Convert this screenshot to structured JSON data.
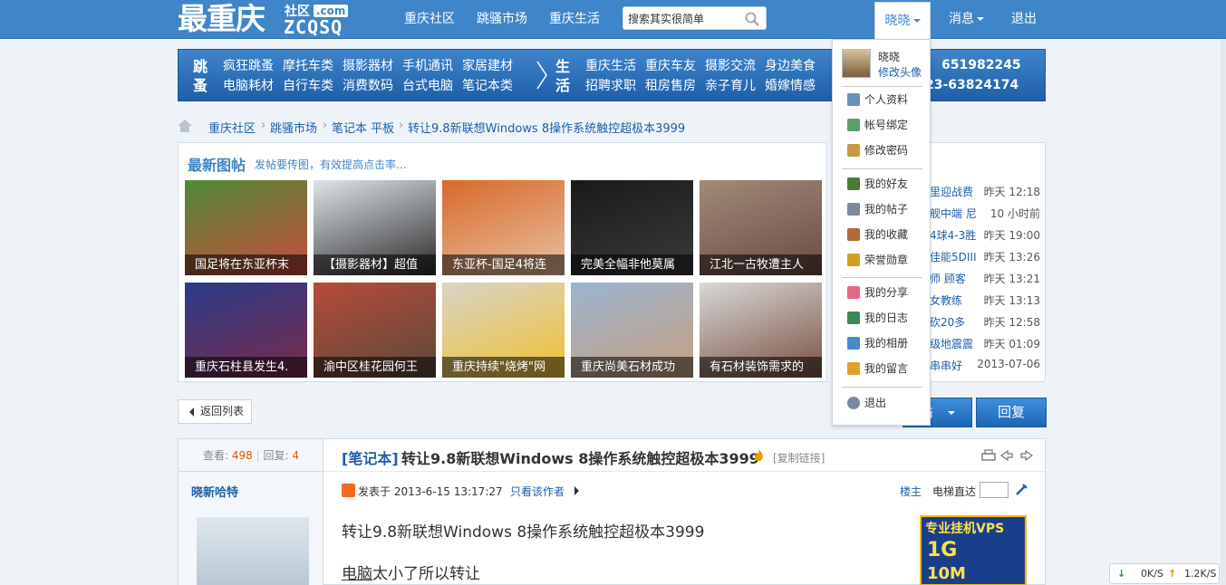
{
  "site": {
    "logo_cn": "最重庆",
    "logo_she": "社区",
    "logo_com": ".com",
    "logo_en": "ZCQSQ"
  },
  "topnav": {
    "items": [
      "重庆社区",
      "跳骚市场",
      "重庆生活"
    ],
    "search_text": "搜索其实很简单",
    "user": "晓晓",
    "messages": "消息",
    "logout": "退出"
  },
  "catbar": {
    "head1": [
      "跳",
      "蚤"
    ],
    "group1_row1": [
      "疯狂跳蚤",
      "摩托车类",
      "摄影器材",
      "手机通讯",
      "家居建材"
    ],
    "group1_row2": [
      "电脑耗材",
      "自行车类",
      "消费数码",
      "台式电脑",
      "笔记本类"
    ],
    "head2": [
      "生",
      "活"
    ],
    "group2_row1": [
      "重庆生活",
      "重庆车友",
      "摄影交流",
      "身边美食"
    ],
    "group2_row2": [
      "招聘求职",
      "租房售房",
      "亲子育儿",
      "婚嫁情感"
    ],
    "phone1": "651982245",
    "phone2": "23-63824174"
  },
  "breadcrumb": [
    "重庆社区",
    "跳骚市场",
    "笔记本 平板",
    "转让9.8新联想Windows 8操作系统触控超极本3999"
  ],
  "latest_images": {
    "title": "最新图帖",
    "subtitle": "发帖要传图，有效提高点击率...",
    "items": [
      {
        "caption": "国足将在东亚杯末",
        "color1": "#4f8a3a",
        "color2": "#c94a3a"
      },
      {
        "caption": "【摄影器材】超值",
        "color1": "#dfe4ea",
        "color2": "#2a2a2a"
      },
      {
        "caption": "东亚杯-国足4将连",
        "color1": "#d9692a",
        "color2": "#e8c0a0"
      },
      {
        "caption": "完美全幅非他莫属",
        "color1": "#1a1a1a",
        "color2": "#3a3a3a"
      },
      {
        "caption": "江北一古牧遭主人",
        "color1": "#a08a78",
        "color2": "#6b4a44"
      },
      {
        "caption": "重庆石柱县发生4.",
        "color1": "#2a3c8a",
        "color2": "#7a2a4a"
      },
      {
        "caption": "渝中区桂花园何王",
        "color1": "#b84a3a",
        "color2": "#5a4a3a"
      },
      {
        "caption": "重庆持续\"烧烤\"网",
        "color1": "#d8d4c8",
        "color2": "#f0c030"
      },
      {
        "caption": "重庆尚美石材成功",
        "color1": "#9ab4d0",
        "color2": "#c8a080"
      },
      {
        "caption": "有石材装饰需求的",
        "color1": "#d8d8d8",
        "color2": "#7a5040"
      }
    ]
  },
  "right_list": [
    {
      "title": "里迎战费",
      "time": "昨天 12:18"
    },
    {
      "title": "舰中端 尼",
      "time": "10 小时前"
    },
    {
      "title": "4球4-3胜",
      "time": "昨天 19:00"
    },
    {
      "title": "佳能5DIII",
      "time": "昨天 13:26"
    },
    {
      "title": "师 顾客",
      "time": "昨天 13:21"
    },
    {
      "title": "女教练",
      "time": "昨天 13:13"
    },
    {
      "title": "砍20多",
      "time": "昨天 12:58"
    },
    {
      "title": "级地震震",
      "time": "昨天 01:09"
    },
    {
      "title": "串串好",
      "time": "2013-07-06"
    }
  ],
  "buttons": {
    "back": "返回列表",
    "new_post": "帖",
    "reply": "回复"
  },
  "thread": {
    "views_label": "查看:",
    "views": "498",
    "replies_label": "回复:",
    "replies": "4",
    "category": "[笔记本]",
    "title": "转让9.8新联想Windows 8操作系统触控超极本3999",
    "copy_link": "[复制链接]",
    "author": "晓新哈特",
    "posted": "发表于 2013-6-15 13:17:27",
    "only_author": "只看该作者",
    "owner": "楼主",
    "elevator": "电梯直达",
    "body_line1": "转让9.8新联想Windows 8操作系统触控超极本3999",
    "body_line2_u": "电脑",
    "body_line2_rest": "太小了所以转让",
    "ad_line1": "专业挂机VPS",
    "ad_line2": "1G",
    "ad_line3": "10M"
  },
  "user_menu": {
    "name": "晓晓",
    "edit_avatar": "修改头像",
    "items": [
      {
        "label": "个人资料",
        "icon_color": "#6b8fb8"
      },
      {
        "label": "帐号绑定",
        "icon_color": "#5aa06a"
      },
      {
        "label": "修改密码",
        "icon_color": "#c89a40"
      },
      {
        "label": "我的好友",
        "icon_color": "#4a7a3a"
      },
      {
        "label": "我的帖子",
        "icon_color": "#7a8a9a"
      },
      {
        "label": "我的收藏",
        "icon_color": "#b06a3a"
      },
      {
        "label": "荣誉勋章",
        "icon_color": "#d0a020"
      },
      {
        "label": "我的分享",
        "icon_color": "#e06a80"
      },
      {
        "label": "我的日志",
        "icon_color": "#3a8a5a"
      },
      {
        "label": "我的相册",
        "icon_color": "#4a8ac8"
      },
      {
        "label": "我的留言",
        "icon_color": "#e0a030"
      },
      {
        "label": "退出",
        "icon_color": "#7a8aa0"
      }
    ]
  },
  "speed": {
    "down": "0K/S",
    "up": "1.2K/S"
  }
}
